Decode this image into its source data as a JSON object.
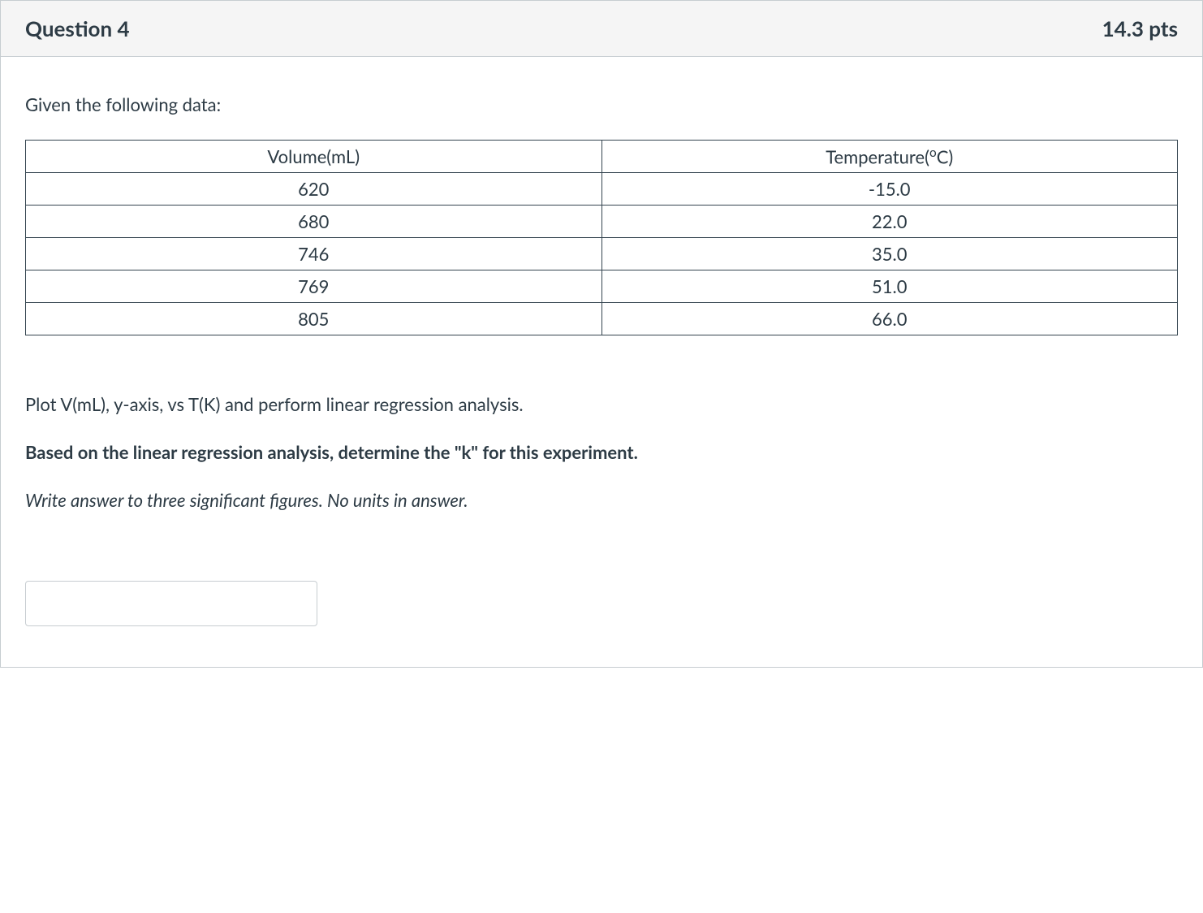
{
  "header": {
    "title": "Question 4",
    "points": "14.3 pts"
  },
  "body": {
    "intro": "Given the following data:",
    "table": {
      "headers": {
        "col1": "Volume(mL)",
        "col2_pre": "Temperature(",
        "col2_sup": "o",
        "col2_post": "C)"
      },
      "rows": [
        {
          "volume": "620",
          "temp": "-15.0"
        },
        {
          "volume": "680",
          "temp": "22.0"
        },
        {
          "volume": "746",
          "temp": "35.0"
        },
        {
          "volume": "769",
          "temp": "51.0"
        },
        {
          "volume": "805",
          "temp": "66.0"
        }
      ]
    },
    "instruction1": "Plot V(mL), y-axis, vs T(K) and perform linear regression analysis.",
    "instruction2": "Based on the linear regression analysis, determine the \"k\" for this experiment.",
    "instruction3": "Write answer to three significant figures. No units in answer.",
    "answer_value": ""
  }
}
